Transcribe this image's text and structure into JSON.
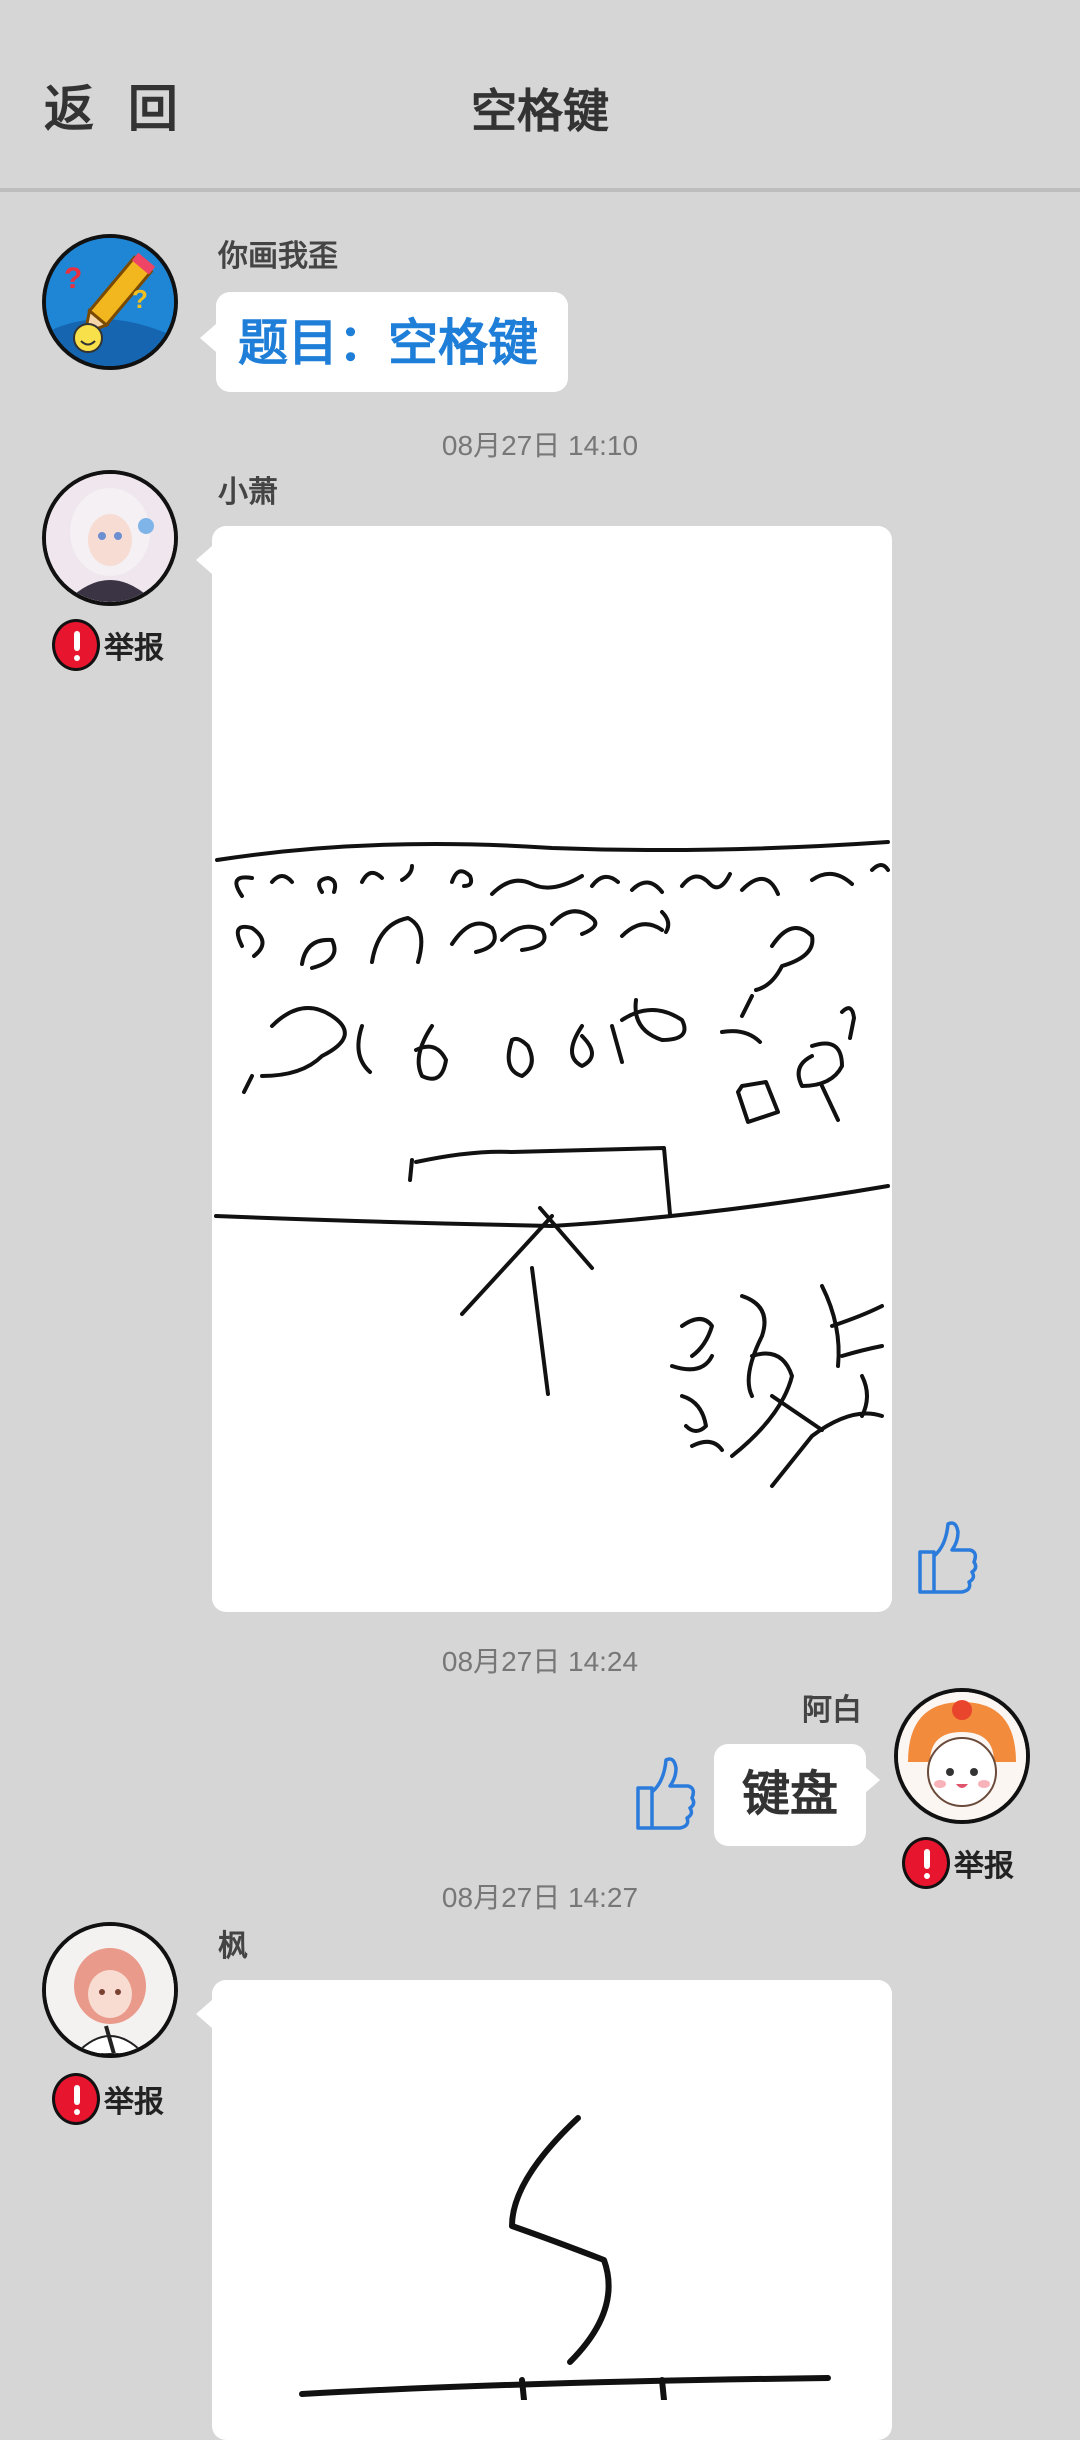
{
  "header": {
    "back_label": "返 回",
    "title": "空格键"
  },
  "prompt": {
    "sender": "你画我歪",
    "text": "题目：空格键"
  },
  "messages": [
    {
      "time": "08月27日  14:10",
      "sender": "小萧",
      "report": "举报"
    },
    {
      "time": "08月27日  14:24",
      "sender": "阿白",
      "text": "键盘",
      "report": "举报"
    },
    {
      "time": "08月27日  14:27",
      "sender": "枫",
      "report": "举报"
    }
  ],
  "icons": {
    "back": "back-button",
    "like": "thumbs-up-icon",
    "report": "exclamation-icon"
  },
  "colors": {
    "background": "#d6d6d6",
    "prompt_text": "#1e7ed8",
    "like_icon": "#2a7bdc",
    "report_badge": "#e8152f"
  }
}
